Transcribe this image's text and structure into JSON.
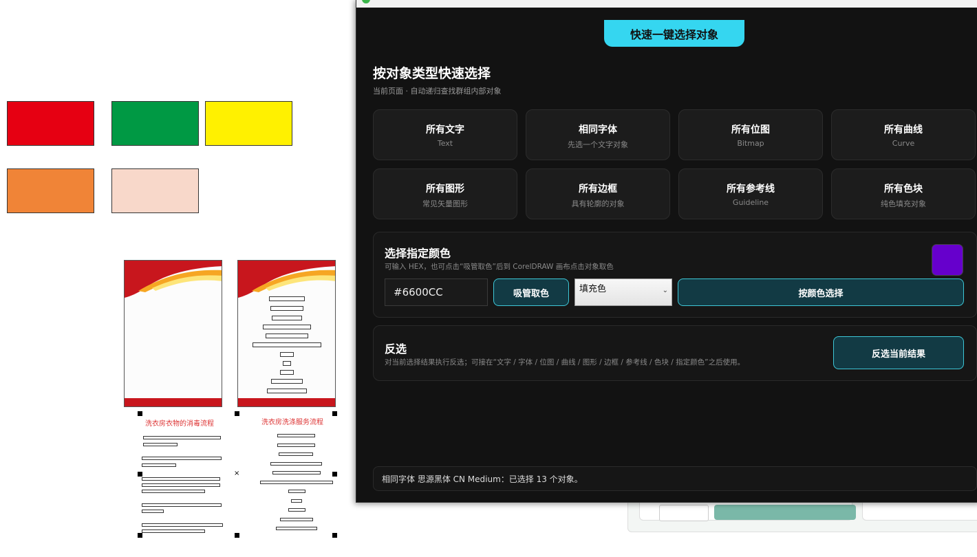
{
  "panel": {
    "header_button": "快速一键选择对象",
    "type_section": {
      "title": "按对象类型快速选择",
      "subtitle": "当前页面 · 自动递归查找群组内部对象",
      "cards": [
        {
          "title": "所有文字",
          "subtitle": "Text"
        },
        {
          "title": "相同字体",
          "subtitle": "先选一个文字对象"
        },
        {
          "title": "所有位图",
          "subtitle": "Bitmap"
        },
        {
          "title": "所有曲线",
          "subtitle": "Curve"
        },
        {
          "title": "所有图形",
          "subtitle": "常见矢量图形"
        },
        {
          "title": "所有边框",
          "subtitle": "具有轮廓的对象"
        },
        {
          "title": "所有参考线",
          "subtitle": "Guideline"
        },
        {
          "title": "所有色块",
          "subtitle": "纯色填充对象"
        }
      ]
    },
    "color_section": {
      "title": "选择指定颜色",
      "subtitle": "可输入 HEX，也可点击“吸管取色”后到 CorelDRAW 画布点击对象取色",
      "hex_value": "#6600CC",
      "swatch_color": "#6600CC",
      "eyedropper_button": "吸管取色",
      "fill_select": "填充色",
      "select_by_color_button": "按颜色选择"
    },
    "invert_section": {
      "title": "反选",
      "subtitle": "对当前选择结果执行反选；可接在“文字 / 字体 / 位图 / 曲线 / 图形 / 边框 / 参考线 / 色块 / 指定颜色”之后使用。",
      "invert_button": "反选当前结果"
    },
    "status": "相同字体 思源黑体 CN Medium：已选择 13 个对象。"
  },
  "canvas": {
    "swatches": [
      "#E60012",
      "#009944",
      "#FFF100",
      "#F08437",
      "#F8D8CA"
    ],
    "poster_titles": [
      "洗衣房衣物的消毒流程",
      "洗衣房洗涤服务流程"
    ]
  },
  "colors": {
    "panel_bg": "#121212",
    "accent": "#35D6F0",
    "teal_button": "#123A44"
  }
}
